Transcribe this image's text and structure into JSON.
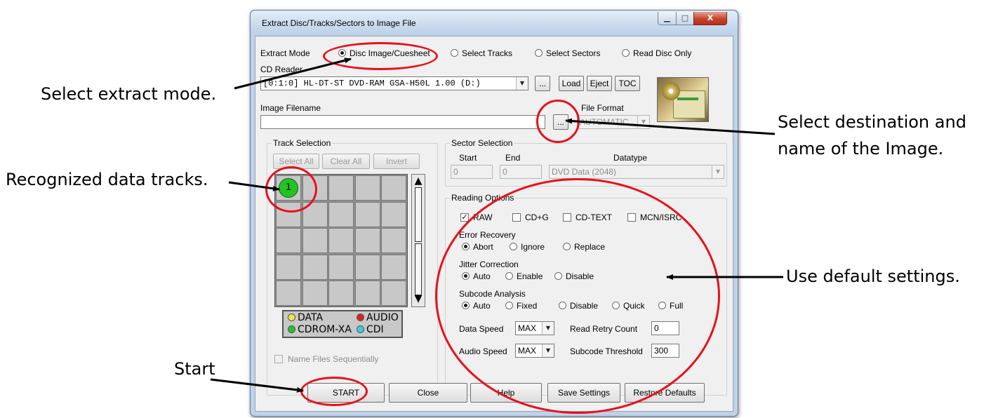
{
  "window": {
    "title": "Extract Disc/Tracks/Sectors to Image File",
    "minimize_glyph": "▁",
    "maximize_glyph": "□",
    "close_glyph": "X"
  },
  "extract_mode": {
    "label": "Extract Mode",
    "options": [
      "Disc Image/Cuesheet",
      "Select Tracks",
      "Select Sectors",
      "Read Disc Only"
    ],
    "selected": "Disc Image/Cuesheet"
  },
  "cd_reader": {
    "label": "CD Reader",
    "value": "[0:1:0] HL-DT-ST DVD-RAM GSA-H50L 1.00 (D:)",
    "browse_label": "...",
    "load_label": "Load",
    "eject_label": "Eject",
    "toc_label": "TOC"
  },
  "image_filename": {
    "label": "Image Filename",
    "value": "",
    "browse_label": "..."
  },
  "file_format": {
    "label": "File Format",
    "value": "AUTOMATIC"
  },
  "track_selection": {
    "label": "Track Selection",
    "select_all_label": "Select All",
    "clear_all_label": "Clear All",
    "invert_label": "Invert",
    "tracks": [
      "1"
    ],
    "track_color": "#22c322",
    "legend": [
      {
        "label": "DATA",
        "color": "#f5e64a"
      },
      {
        "label": "AUDIO",
        "color": "#e02020"
      },
      {
        "label": "CDROM-XA",
        "color": "#22c322"
      },
      {
        "label": "CDI",
        "color": "#38d0e0"
      }
    ],
    "name_sequentially_label": "Name Files Sequentially"
  },
  "sector_selection": {
    "label": "Sector Selection",
    "start_label": "Start",
    "end_label": "End",
    "datatype_label": "Datatype",
    "start_value": "0",
    "end_value": "0",
    "datatype_value": "DVD Data (2048)"
  },
  "reading_options": {
    "label": "Reading Options",
    "checks": [
      {
        "label": "RAW",
        "checked": true
      },
      {
        "label": "CD+G",
        "checked": false
      },
      {
        "label": "CD-TEXT",
        "checked": false
      },
      {
        "label": "MCN/ISRC",
        "checked": false
      }
    ],
    "check_glyph": "✓",
    "error_recovery": {
      "label": "Error Recovery",
      "options": [
        "Abort",
        "Ignore",
        "Replace"
      ],
      "selected": "Abort"
    },
    "jitter_correction": {
      "label": "Jitter Correction",
      "options": [
        "Auto",
        "Enable",
        "Disable"
      ],
      "selected": "Auto"
    },
    "subcode_analysis": {
      "label": "Subcode Analysis",
      "options": [
        "Auto",
        "Fixed",
        "Disable",
        "Quick",
        "Full"
      ],
      "selected": "Auto"
    },
    "data_speed_label": "Data Speed",
    "data_speed_value": "MAX",
    "audio_speed_label": "Audio Speed",
    "audio_speed_value": "MAX",
    "read_retry_label": "Read Retry Count",
    "read_retry_value": "0",
    "subcode_threshold_label": "Subcode Threshold",
    "subcode_threshold_value": "300"
  },
  "footer": {
    "start_label": "START",
    "close_label": "Close",
    "help_label": "Help",
    "save_label": "Save Settings",
    "restore_label": "Restore Defaults"
  },
  "annotations": {
    "extract_mode": "Select extract mode.",
    "destination_line1": "Select destination and",
    "destination_line2": "name of the Image.",
    "tracks": "Recognized data tracks.",
    "defaults": "Use default settings.",
    "start": "Start",
    "highlight_color": "#e8101c"
  }
}
